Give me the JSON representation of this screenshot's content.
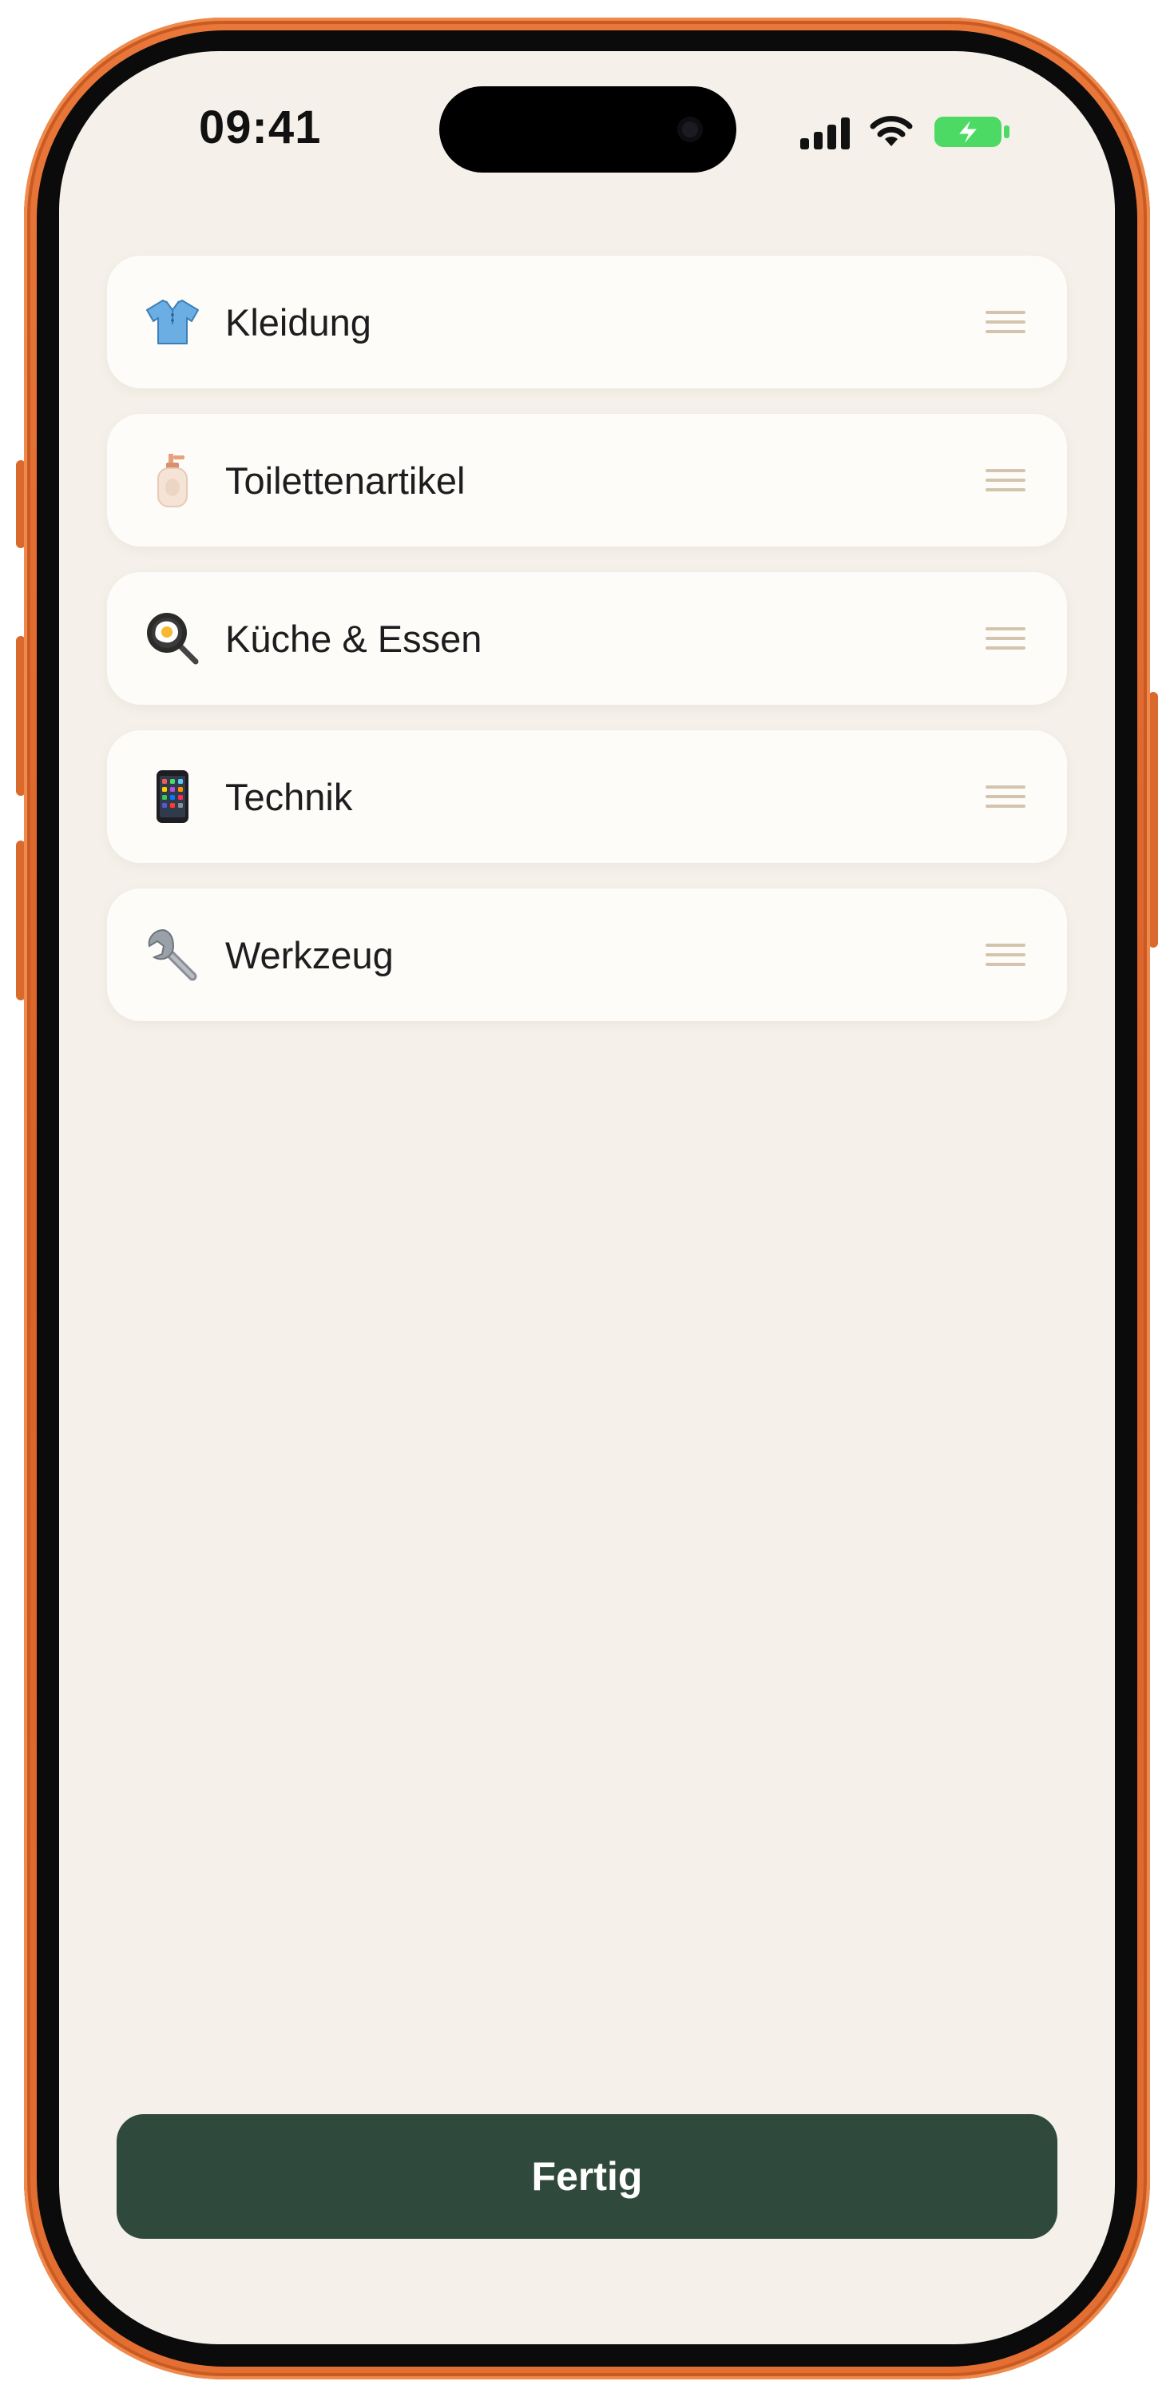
{
  "status_bar": {
    "time": "09:41",
    "battery_state": "charging"
  },
  "colors": {
    "frame_accent": "#e46f32",
    "background": "#f5f1ea",
    "card": "#fdfcf8",
    "handle": "#d4c4ad",
    "primary_button": "#2f4a3c",
    "battery": "#4cd964"
  },
  "categories": [
    {
      "label": "Kleidung",
      "icon": "shirt-icon"
    },
    {
      "label": "Toilettenartikel",
      "icon": "lotion-bottle-icon"
    },
    {
      "label": "Küche & Essen",
      "icon": "frying-pan-icon"
    },
    {
      "label": "Technik",
      "icon": "smartphone-icon"
    },
    {
      "label": "Werkzeug",
      "icon": "wrench-icon"
    }
  ],
  "done_button": {
    "label": "Fertig"
  }
}
